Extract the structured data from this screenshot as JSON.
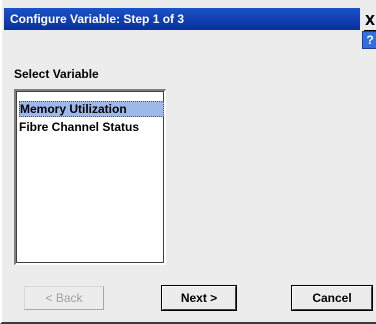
{
  "window": {
    "title": "Configure Variable: Step 1 of 3",
    "close_label": "X",
    "help_label": "?"
  },
  "main": {
    "section_label": "Select Variable",
    "list_items": [
      {
        "label": "Memory Utilization",
        "selected": true
      },
      {
        "label": "Fibre Channel Status",
        "selected": false
      }
    ]
  },
  "buttons": {
    "back_label": "< Back",
    "back_enabled": false,
    "next_label": "Next >",
    "cancel_label": "Cancel"
  },
  "colors": {
    "title_bar": "#0a2f9c",
    "selection": "#9db8ea",
    "help_button": "#2f6fe0"
  }
}
